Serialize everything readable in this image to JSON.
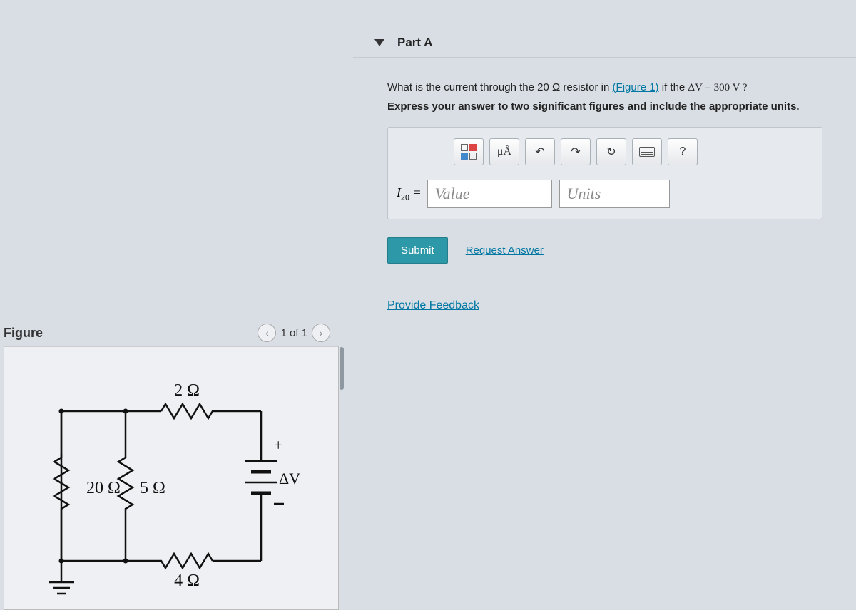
{
  "part": {
    "label": "Part A"
  },
  "question": {
    "text_before_link": "What is the current through the 20 Ω resistor in ",
    "figure_link": "(Figure 1)",
    "text_after_link": " if the ",
    "delta_expr": "ΔV = 300  V ?",
    "instruction": "Express your answer to two significant figures and include the appropriate units."
  },
  "toolbar": {
    "units_btn": "μÅ",
    "help_btn": "?"
  },
  "answer": {
    "variable": "I",
    "subscript": "20",
    "equals": " = ",
    "value_placeholder": "Value",
    "units_placeholder": "Units"
  },
  "actions": {
    "submit": "Submit",
    "request": "Request Answer"
  },
  "feedback": {
    "link": "Provide Feedback"
  },
  "figure": {
    "title": "Figure",
    "counter": "1 of 1",
    "r1": "2 Ω",
    "r2": "20 Ω",
    "r3": "5 Ω",
    "r4": "4 Ω",
    "dv": "ΔV",
    "plus": "+"
  }
}
